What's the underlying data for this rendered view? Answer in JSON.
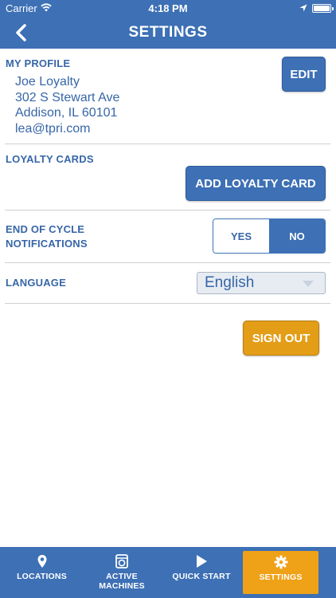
{
  "status_bar": {
    "carrier": "Carrier",
    "time": "4:18 PM"
  },
  "nav": {
    "title": "SETTINGS",
    "back_icon": "chevron-left-icon"
  },
  "profile": {
    "label": "MY PROFILE",
    "edit_label": "EDIT",
    "name": "Joe Loyalty",
    "street": "302 S Stewart Ave",
    "city": "Addison, IL 60101",
    "email": "lea@tpri.com"
  },
  "loyalty": {
    "label": "LOYALTY CARDS",
    "add_label": "ADD LOYALTY CARD"
  },
  "notifications": {
    "label_line1": "END OF CYCLE",
    "label_line2": "NOTIFICATIONS",
    "yes_label": "YES",
    "no_label": "NO",
    "selected": "NO"
  },
  "language": {
    "label": "LANGUAGE",
    "selected": "English"
  },
  "sign_out_label": "SIGN OUT",
  "tabs": [
    {
      "icon": "location-pin-icon",
      "line1": "LOCATIONS",
      "line2": ""
    },
    {
      "icon": "washing-machine-icon",
      "line1": "ACTIVE",
      "line2": "MACHINES"
    },
    {
      "icon": "play-icon",
      "line1": "QUICK START",
      "line2": ""
    },
    {
      "icon": "gear-icon",
      "line1": "SETTINGS",
      "line2": "",
      "active": true
    }
  ],
  "colors": {
    "primary": "#3d70b5",
    "text_blue": "#3766a8",
    "accent_orange": "#e39d17",
    "tab_active": "#efa117"
  }
}
